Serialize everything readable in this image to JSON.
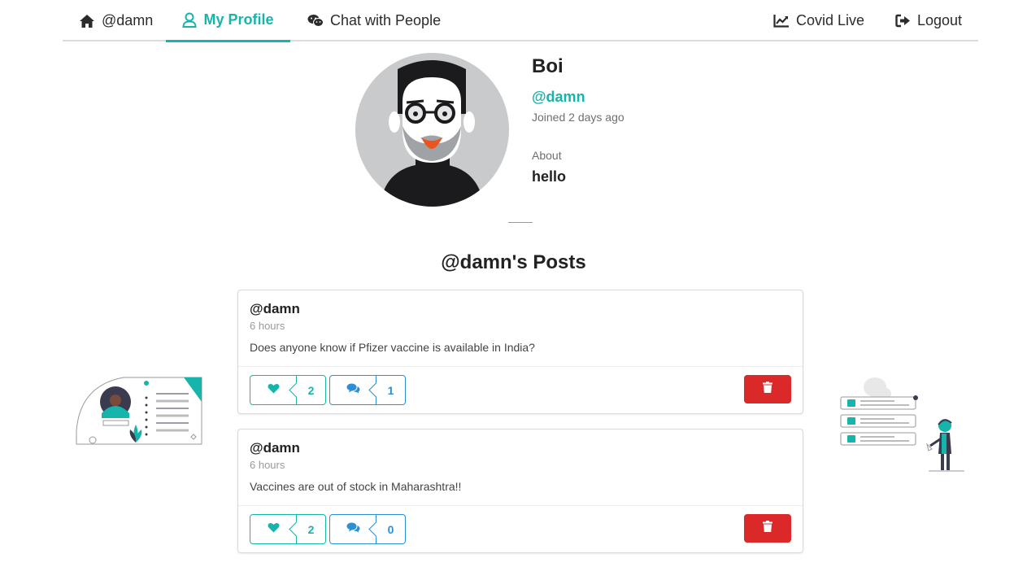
{
  "nav": {
    "home_label": "@damn",
    "profile_label": "My Profile",
    "chat_label": "Chat with People",
    "covid_label": "Covid Live",
    "logout_label": "Logout"
  },
  "profile": {
    "name": "Boi",
    "handle": "@damn",
    "joined": "Joined 2 days ago",
    "about_label": "About",
    "about_text": "hello"
  },
  "posts_title": "@damn's Posts",
  "posts": [
    {
      "author": "@damn",
      "time": "6 hours",
      "text": "Does anyone know if Pfizer vaccine is available in India?",
      "likes": "2",
      "comments": "1"
    },
    {
      "author": "@damn",
      "time": "6 hours",
      "text": "Vaccines are out of stock in Maharashtra!!",
      "likes": "2",
      "comments": "0"
    }
  ],
  "colors": {
    "accent": "#16b5ab",
    "comment_blue": "#2b8fd6",
    "delete_red": "#db2828"
  },
  "icons": {
    "home": "home-icon",
    "profile": "user-icon",
    "chat": "wechat-icon",
    "covid": "line-chart-icon",
    "logout": "sign-out-icon",
    "like": "heart-icon",
    "comment": "comments-icon",
    "delete": "trash-icon"
  }
}
